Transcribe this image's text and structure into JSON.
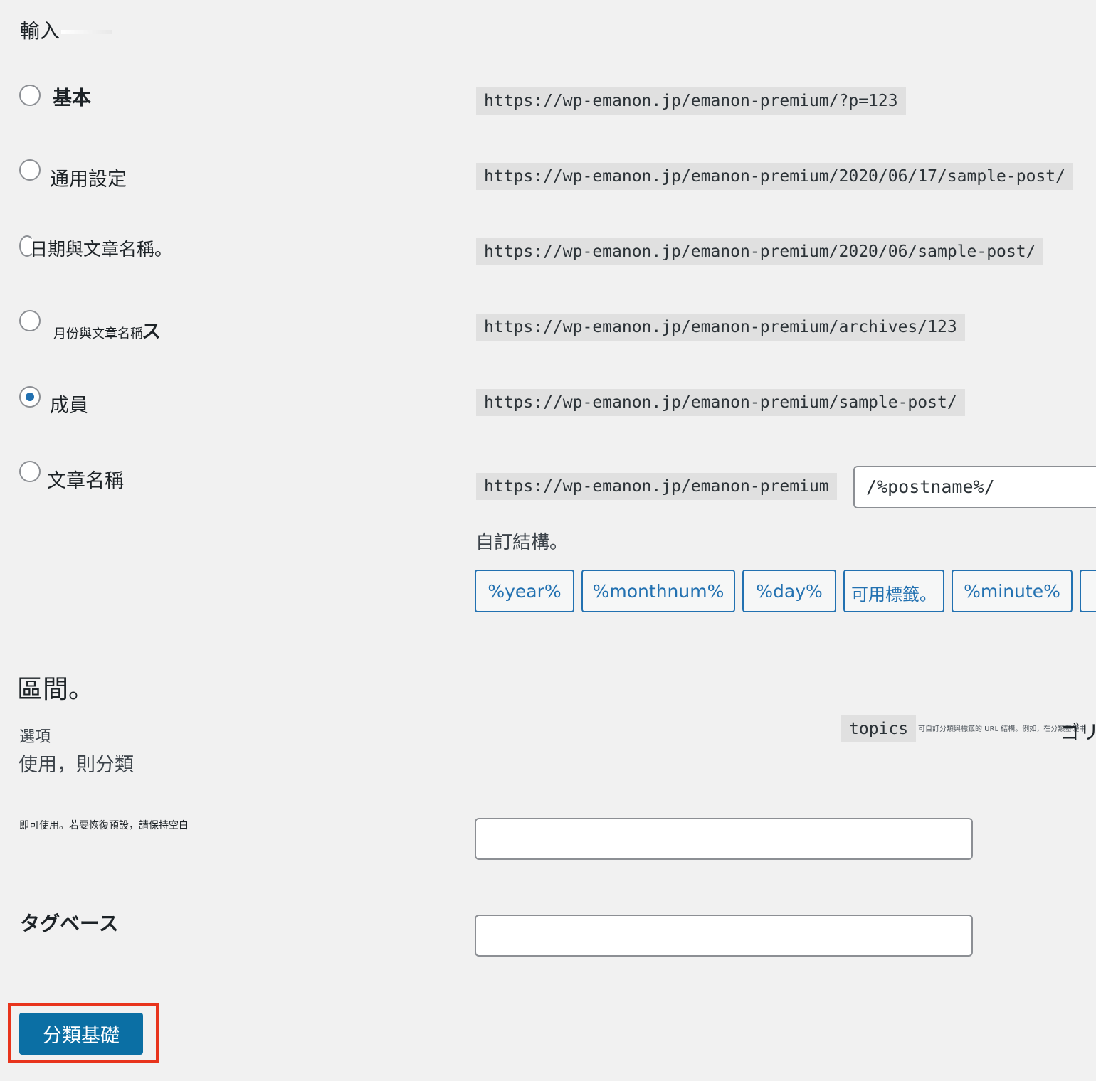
{
  "header": {
    "title": "輸入"
  },
  "permalink_options": [
    {
      "label": "基本",
      "url": "https://wp-emanon.jp/emanon-premium/?p=123",
      "checked": false
    },
    {
      "label": "通用設定",
      "url": "https://wp-emanon.jp/emanon-premium/2020/06/17/sample-post/",
      "checked": false
    },
    {
      "label": "日期與文章名稱。",
      "url": "https://wp-emanon.jp/emanon-premium/2020/06/sample-post/",
      "checked": false
    },
    {
      "label": "月份與文章名稱",
      "label_tail": "ス",
      "url": "https://wp-emanon.jp/emanon-premium/archives/123",
      "checked": false
    },
    {
      "label": "成員",
      "url": "https://wp-emanon.jp/emanon-premium/sample-post/",
      "checked": true
    },
    {
      "label": "文章名稱",
      "url": "https://wp-emanon.jp/emanon-premium",
      "checked": false
    }
  ],
  "custom_structure": {
    "value": "/%postname%/",
    "help": "自訂結構。",
    "tags": [
      "%year%",
      "%monthnum%",
      "%day%",
      "可用標籤。",
      "%minute%"
    ]
  },
  "section": {
    "title": "區間。",
    "category_label": "選項",
    "optional_text": "使用，則分類",
    "category_example_code": "topics",
    "category_note_small": "可自訂分類與標籤的 URL 結構。例如，在分類基礎中",
    "category_note_tail": "ゴリー",
    "category_desc": "即可使用。若要恢復預設，請保持空白",
    "category_base_value": "",
    "tag_base_label": "タグベース",
    "tag_base_value": ""
  },
  "save_button": {
    "label": "分類基礎"
  },
  "colors": {
    "accent": "#2271b1",
    "button_bg": "#0b6fa4",
    "highlight": "#e8341c",
    "page_bg": "#f1f1f1",
    "code_bg": "#e0e0e0"
  }
}
